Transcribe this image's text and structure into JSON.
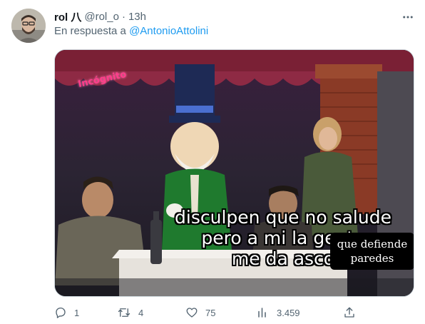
{
  "tweet": {
    "author_name": "rol 八",
    "author_handle": "@rol_o",
    "separator": "·",
    "time": "13h",
    "reply_prefix": "En respuesta a",
    "reply_mention": "@AntonioAttolini"
  },
  "media": {
    "sign_text": "Incógnito",
    "caption_line1": "disculpen que no salude",
    "caption_line2": "pero a mi la gente",
    "caption_line3": "me da asco",
    "sticker_line1": "que defiende",
    "sticker_line2": "paredes"
  },
  "actions": {
    "reply_count": "1",
    "retweet_count": "4",
    "like_count": "75",
    "views_count": "3.459"
  },
  "icons": {
    "more": "more-icon",
    "reply": "reply-icon",
    "retweet": "retweet-icon",
    "like": "like-icon",
    "views": "views-icon",
    "share": "share-icon"
  },
  "colors": {
    "text_primary": "#0f1419",
    "text_secondary": "#536471",
    "link": "#1d9bf0",
    "border": "#cfd9de"
  }
}
